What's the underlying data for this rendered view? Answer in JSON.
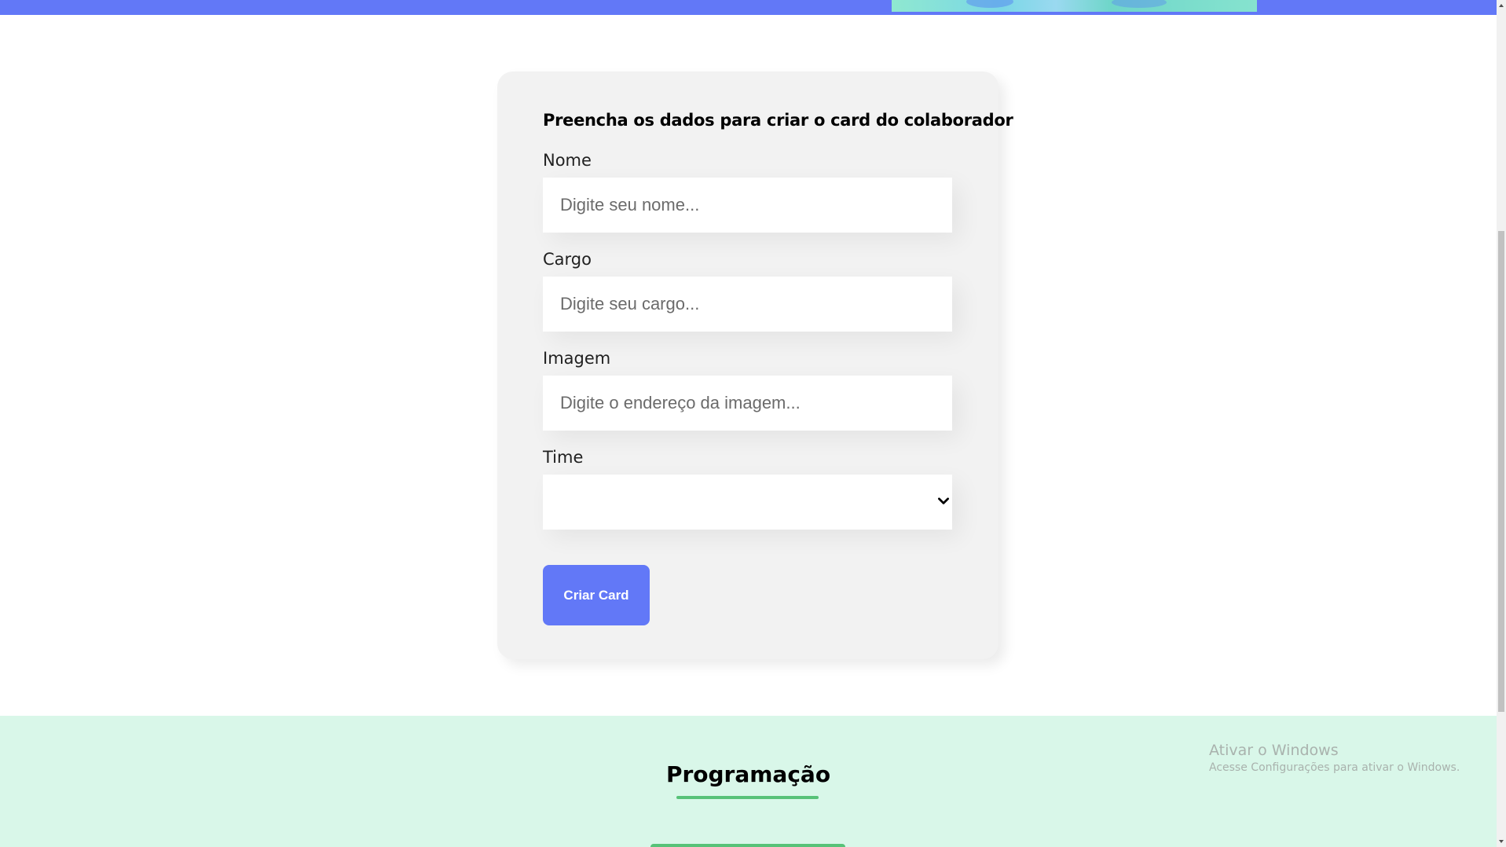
{
  "form": {
    "title": "Preencha os dados para criar o card do colaborador",
    "fields": [
      {
        "label": "Nome",
        "placeholder": "Digite seu nome..."
      },
      {
        "label": "Cargo",
        "placeholder": "Digite seu cargo..."
      },
      {
        "label": "Imagem",
        "placeholder": "Digite o endereço da imagem..."
      }
    ],
    "team": {
      "label": "Time",
      "selected": ""
    },
    "submit_label": "Criar Card"
  },
  "program": {
    "title": "Programação"
  },
  "watermark": {
    "title": "Ativar o Windows",
    "subtitle": "Acesse Configurações para ativar o Windows."
  },
  "colors": {
    "accent": "#6278f7",
    "card_bg": "#f2f2f2",
    "section_bg": "#d9f7e9",
    "team_green": "#57c278"
  },
  "icons": {
    "select": "chevron-down-icon",
    "scroll_up": "scroll-up-arrow-icon",
    "scroll_down": "scroll-down-arrow-icon"
  }
}
